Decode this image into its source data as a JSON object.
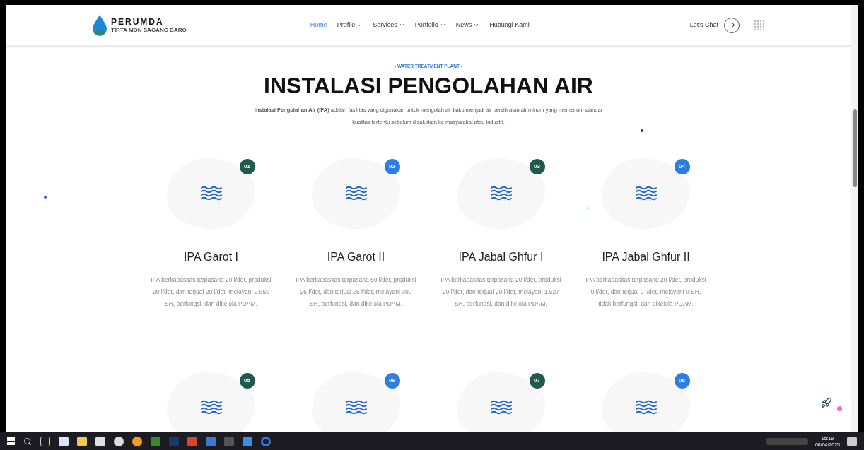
{
  "header": {
    "logo": {
      "name": "PERUMDA",
      "tagline": "TIRTA MON SAGANG BARO"
    },
    "nav": [
      {
        "label": "Home",
        "selected": true,
        "dropdown": false
      },
      {
        "label": "Profile",
        "selected": false,
        "dropdown": true
      },
      {
        "label": "Services",
        "selected": false,
        "dropdown": true
      },
      {
        "label": "Portfolio",
        "selected": false,
        "dropdown": true
      },
      {
        "label": "News",
        "selected": false,
        "dropdown": true
      },
      {
        "label": "Hubungi Kami",
        "selected": false,
        "dropdown": false
      }
    ],
    "chat": "Let's Chat"
  },
  "section": {
    "eyebrow": "• WATER TREATMENT PLANT •",
    "title": "INSTALASI PENGOLAHAN AIR",
    "intro": "**Instalasi Pengolahan Air (IPA)** adalah fasilitas yang digunakan untuk mengolah air baku menjadi air bersih atau air minum yang memenuhi standar kualitas tertentu sebelum disalurkan ke masyarakat atau industri."
  },
  "cards": [
    {
      "number": "01",
      "color": "#1e5b4d",
      "title": "IPA Garot I",
      "text": "IPA berkapasitas terpasang 20 l/det, produksi 20 l/det, dan terjual 20 l/det, melayani 2.650 SR, berfungsi, dan dikelola PDAM."
    },
    {
      "number": "02",
      "color": "#2f7de1",
      "title": "IPA Garot II",
      "text": "IPA berkapasitas terpasang 50 l/det, produksi 25 l/det, dan terjual 25 l/det, melayani 300 SR, berfungsi, dan dikelola PDAM."
    },
    {
      "number": "03",
      "color": "#1e5b4d",
      "title": "IPA Jabal Ghfur I",
      "text": "IPA berkapasitas terpasang 20 l/det, produksi 20 l/det, dan terjual 20 l/det, melayani 1.527 SR, berfungsi, dan dikelola PDAM."
    },
    {
      "number": "04",
      "color": "#2f7de1",
      "title": "IPA Jabal Ghfur II",
      "text": "IPA berkapasitas terpasang 20 l/det, produksi 0 l/det, dan terjual 0 l/det, melayani 0 SR, tidak berfungsi, dan dikelola PDAM."
    },
    {
      "number": "05",
      "color": "#1e5b4d"
    },
    {
      "number": "06",
      "color": "#2f7de1"
    },
    {
      "number": "07",
      "color": "#1e5b4d"
    },
    {
      "number": "08",
      "color": "#2f7de1"
    }
  ],
  "taskbar": {
    "time": "15:19",
    "date": "08/04/2025"
  }
}
